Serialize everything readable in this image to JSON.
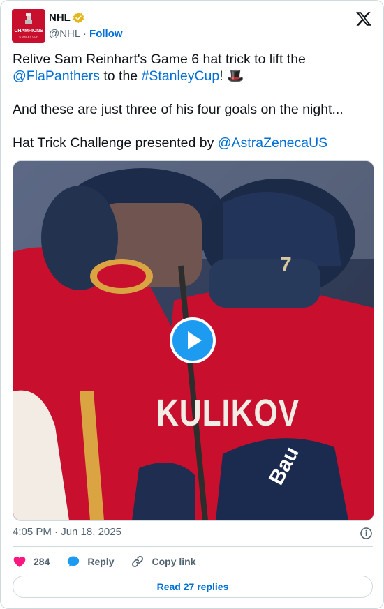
{
  "author": {
    "avatar_line1": "CHAMPIONS",
    "avatar_line2": "STANLEY CUP",
    "name": "NHL",
    "handle": "@NHL",
    "separator": "·",
    "follow": "Follow"
  },
  "tweet": {
    "line1": "Relive Sam Reinhart's Game 6 hat trick to lift the",
    "mention1": "@FlaPanthers",
    "mid1": " to the ",
    "hashtag": "#StanleyCup",
    "end1": "! 🎩",
    "line2": "And these are just three of his four goals on the night...",
    "line3": "Hat Trick Challenge presented by ",
    "mention2": "@AstraZenecaUS"
  },
  "media": {
    "jersey_text": "KULIKOV",
    "number": "7",
    "glove_text": "Bau"
  },
  "meta": {
    "timestamp": "4:05 PM · Jun 18, 2025"
  },
  "actions": {
    "likes": "284",
    "reply": "Reply",
    "copy_link": "Copy link"
  },
  "read_replies": "Read 27 replies",
  "colors": {
    "link": "#006fd6",
    "like": "#f91880",
    "play": "#1d9bf0",
    "jersey_red": "#c8102e"
  }
}
